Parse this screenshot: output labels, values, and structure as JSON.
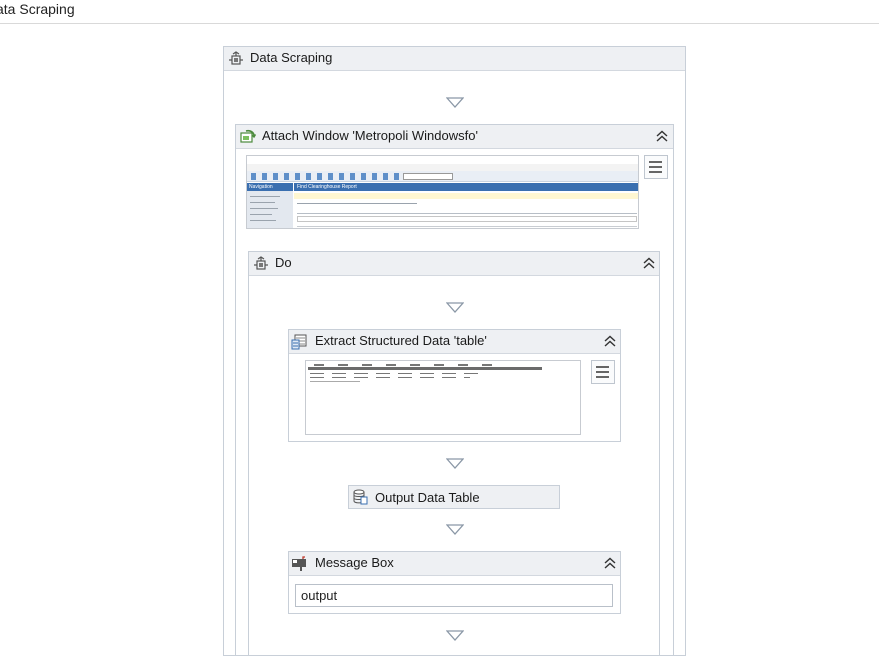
{
  "breadcrumb": {
    "text": "ata Scraping"
  },
  "sequence": {
    "title": "Data Scraping"
  },
  "attach_window": {
    "title": "Attach Window 'Metropoli Windowsfo'"
  },
  "do_block": {
    "title": "Do"
  },
  "extract": {
    "title": "Extract Structured Data 'table'"
  },
  "output_table": {
    "title": "Output Data Table"
  },
  "message_box": {
    "title": "Message Box",
    "input_value": "output"
  },
  "thumbnail_window": {
    "nav_header": "Navigation",
    "report_title": "Find Clearinghouse Report"
  },
  "icons": {
    "sequence": "sequence-icon",
    "attach": "attach-window-icon",
    "extract": "extract-data-icon",
    "output": "database-icon",
    "message": "message-box-icon",
    "collapse": "double-chevron-up-icon",
    "menu": "hamburger-menu-icon",
    "drop": "drop-target-arrow-icon"
  },
  "colors": {
    "header_bg": "#eef0f3",
    "border": "#c8cfd8",
    "accent_blue": "#3a6fb0"
  }
}
